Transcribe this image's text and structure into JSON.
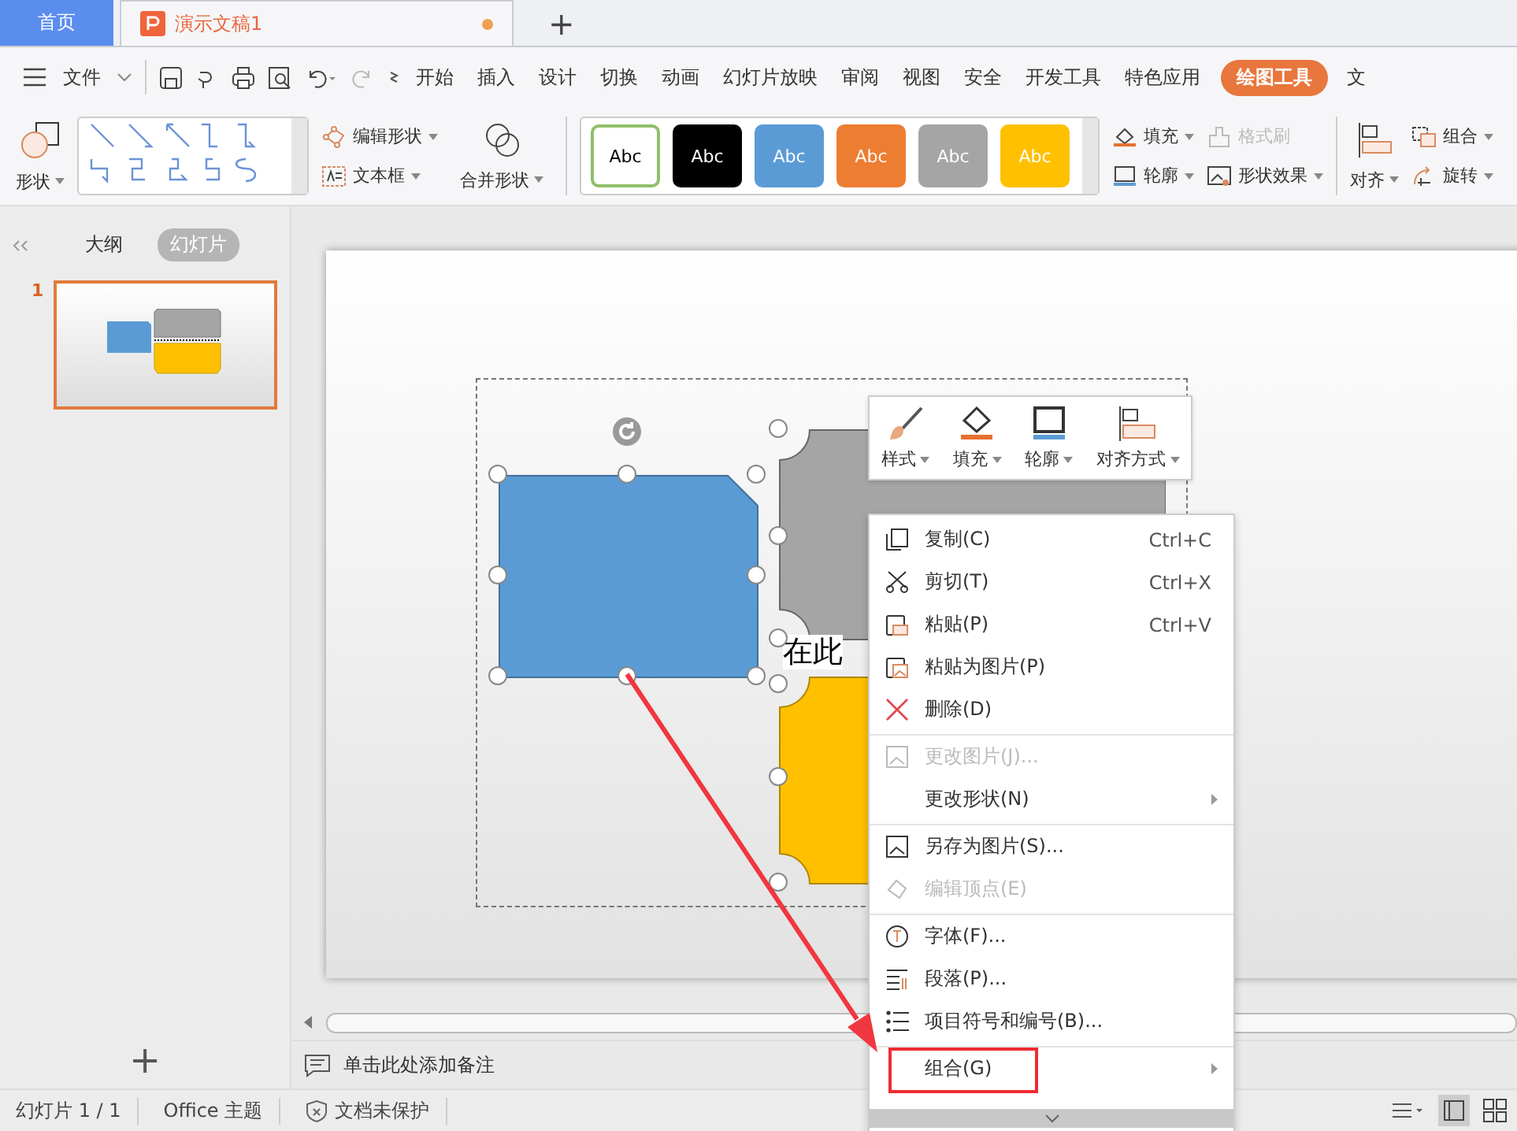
{
  "tabs": [
    {
      "label": "首页",
      "kind": "home",
      "selected": false
    },
    {
      "label": "演示文稿1",
      "kind": "doc",
      "selected": true,
      "unsaved": true
    }
  ],
  "new_tab": "+",
  "menu": {
    "file": "文件",
    "items": [
      {
        "label": "开始",
        "selected": false
      },
      {
        "label": "插入",
        "selected": false
      },
      {
        "label": "设计",
        "selected": false
      },
      {
        "label": "切换",
        "selected": false
      },
      {
        "label": "动画",
        "selected": false
      },
      {
        "label": "幻灯片放映",
        "selected": false
      },
      {
        "label": "审阅",
        "selected": false
      },
      {
        "label": "视图",
        "selected": false
      },
      {
        "label": "安全",
        "selected": false
      },
      {
        "label": "开发工具",
        "selected": false
      },
      {
        "label": "特色应用",
        "selected": false
      },
      {
        "label": "绘图工具",
        "selected": true
      },
      {
        "label": "文",
        "selected": false
      }
    ]
  },
  "ribbon": {
    "shape": "形状",
    "edit_shape": "编辑形状",
    "text_box": "文本框",
    "merge": "合并形状",
    "styles": [
      {
        "label": "Abc",
        "color": "#ffffff"
      },
      {
        "label": "Abc",
        "color": "#000000"
      },
      {
        "label": "Abc",
        "color": "#5b9bd5"
      },
      {
        "label": "Abc",
        "color": "#ed7d31"
      },
      {
        "label": "Abc",
        "color": "#a5a5a5"
      },
      {
        "label": "Abc",
        "color": "#ffc000"
      }
    ],
    "fill": "填充",
    "format_painter": {
      "label": "格式刷",
      "disabled": true
    },
    "outline": "轮廓",
    "effects": "形状效果",
    "align": "对齐",
    "group": "组合",
    "rotate": "旋转"
  },
  "side_panel": {
    "tabs": [
      {
        "label": "大纲",
        "selected": false
      },
      {
        "label": "幻灯片",
        "selected": true
      }
    ],
    "slides": [
      {
        "number": "1",
        "selected": true
      }
    ],
    "add": "+"
  },
  "slide": {
    "text": "在此"
  },
  "float_toolbar": [
    {
      "label": "样式"
    },
    {
      "label": "填充"
    },
    {
      "label": "轮廓"
    },
    {
      "label": "对齐方式"
    }
  ],
  "context_menu": [
    {
      "label": "复制(C)",
      "shortcut": "Ctrl+C",
      "disabled": false,
      "submenu": false,
      "separator_before": false,
      "highlighted": false
    },
    {
      "label": "剪切(T)",
      "shortcut": "Ctrl+X",
      "disabled": false,
      "submenu": false,
      "separator_before": false,
      "highlighted": false
    },
    {
      "label": "粘贴(P)",
      "shortcut": "Ctrl+V",
      "disabled": false,
      "submenu": false,
      "separator_before": false,
      "highlighted": false
    },
    {
      "label": "粘贴为图片(P)",
      "disabled": false,
      "submenu": false,
      "separator_before": false,
      "highlighted": false
    },
    {
      "label": "删除(D)",
      "disabled": false,
      "submenu": false,
      "separator_before": false,
      "highlighted": false
    },
    {
      "label": "更改图片(J)...",
      "disabled": true,
      "submenu": false,
      "separator_before": true,
      "highlighted": false
    },
    {
      "label": "更改形状(N)",
      "disabled": false,
      "submenu": true,
      "separator_before": false,
      "highlighted": false
    },
    {
      "label": "另存为图片(S)...",
      "disabled": false,
      "submenu": false,
      "separator_before": true,
      "highlighted": false
    },
    {
      "label": "编辑顶点(E)",
      "disabled": true,
      "submenu": false,
      "separator_before": false,
      "highlighted": false
    },
    {
      "label": "字体(F)...",
      "disabled": false,
      "submenu": false,
      "separator_before": true,
      "highlighted": false
    },
    {
      "label": "段落(P)...",
      "disabled": false,
      "submenu": false,
      "separator_before": false,
      "highlighted": false
    },
    {
      "label": "项目符号和编号(B)...",
      "disabled": false,
      "submenu": false,
      "separator_before": false,
      "highlighted": false
    },
    {
      "label": "组合(G)",
      "disabled": false,
      "submenu": true,
      "separator_before": true,
      "highlighted": true
    }
  ],
  "notes_placeholder": "单击此处添加备注",
  "status_bar": {
    "slide_count": "幻灯片 1 / 1",
    "theme": "Office 主题",
    "protection": "文档未保护"
  }
}
